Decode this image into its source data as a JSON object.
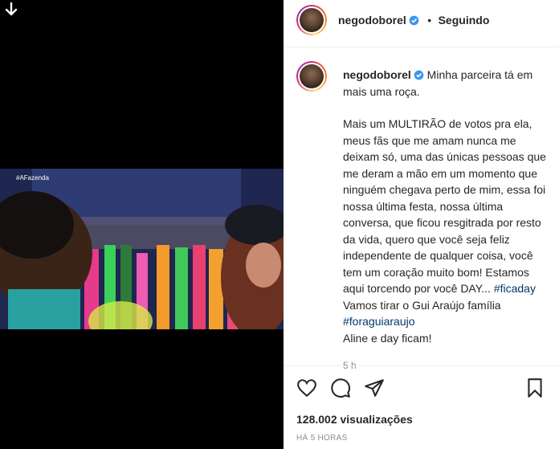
{
  "post": {
    "username": "negodoborel",
    "follow_status": "Seguindo",
    "separator": "•",
    "caption_first": "Minha parceira tá em mais uma roça.",
    "caption_paragraph": "Mais um MULTIRÃO de votos pra ela, meus fãs que me amam nunca me deixam só, uma das únicas pessoas que me deram a mão em um momento que ninguém chegava perto de mim, essa foi nossa última festa, nossa última conversa, que ficou resgitrada por resto da vida, quero que você seja feliz independente de qualquer coisa, você tem um coração muito bom! Estamos aqui torcendo por você DAY...",
    "hashtag_1": "#ficaday",
    "line_2": "Vamos tirar o Gui Araújo família",
    "hashtag_2": "#foraguiaraujo",
    "line_3": "Aline e day ficam!",
    "time_ago": "5 h",
    "views": "128.002 visualizações",
    "posted": "HÁ 5 HORAS"
  },
  "video": {
    "watermark": "#AFazenda"
  },
  "icons": [
    "down-arrow-icon",
    "verified-icon",
    "heart-icon",
    "comment-icon",
    "share-icon",
    "bookmark-icon"
  ],
  "colors": {
    "verified": "#3897f0",
    "hashtag": "#00376b",
    "muted": "#8e8e8e"
  }
}
